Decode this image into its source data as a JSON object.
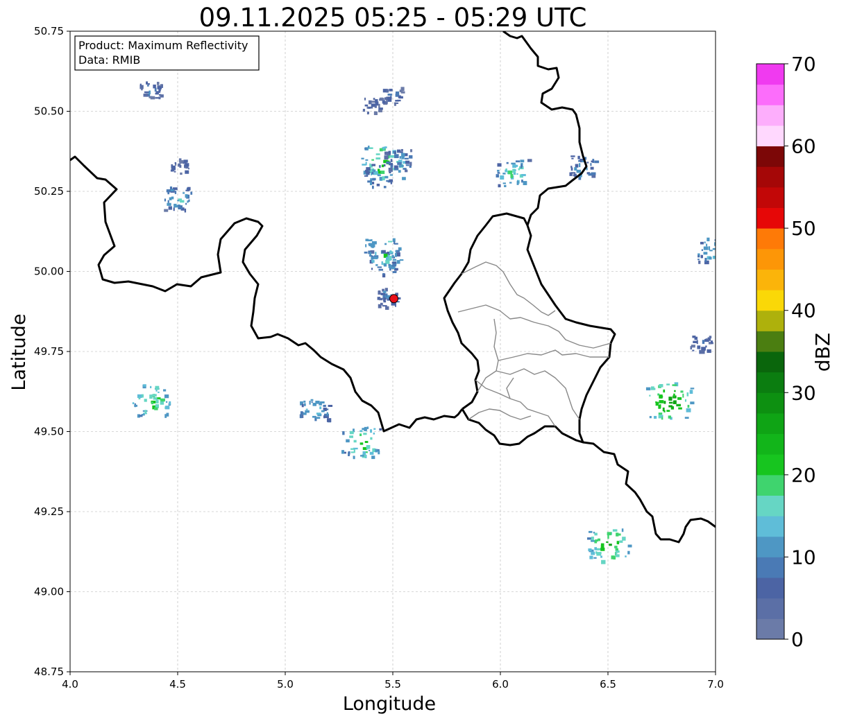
{
  "title": "09.11.2025 05:25 - 05:29 UTC",
  "info_box": {
    "line1": "Product: Maximum Reflectivity",
    "line2": "Data: RMIB"
  },
  "axes": {
    "xlabel": "Longitude",
    "ylabel": "Latitude",
    "xlim": [
      4.0,
      7.0
    ],
    "ylim": [
      48.75,
      50.75
    ],
    "xticks": [
      4.0,
      4.5,
      5.0,
      5.5,
      6.0,
      6.5,
      7.0
    ],
    "xtick_labels": [
      "4.0",
      "4.5",
      "5.0",
      "5.5",
      "6.0",
      "6.5",
      "7.0"
    ],
    "yticks": [
      48.75,
      49.0,
      49.25,
      49.5,
      49.75,
      50.0,
      50.25,
      50.5,
      50.75
    ],
    "ytick_labels": [
      "48.75",
      "49.00",
      "49.25",
      "49.50",
      "49.75",
      "50.00",
      "50.25",
      "50.50",
      "50.75"
    ],
    "grid": true
  },
  "colorbar": {
    "label": "dBZ",
    "min": 0,
    "max": 70,
    "ticks": [
      0,
      10,
      20,
      30,
      40,
      50,
      60,
      70
    ],
    "tick_labels": [
      "0",
      "10",
      "20",
      "30",
      "40",
      "50",
      "60",
      "70"
    ],
    "colors": [
      "#6b7ba8",
      "#5b6fa6",
      "#4c64a4",
      "#4a7ab5",
      "#4e97c4",
      "#5fbdd8",
      "#66d6c4",
      "#3fd46e",
      "#17c51f",
      "#12b51a",
      "#0fa415",
      "#0d9011",
      "#0b7d10",
      "#0a660c",
      "#4b7e11",
      "#aeb10c",
      "#fad807",
      "#fbb40a",
      "#fd9607",
      "#fe7a07",
      "#e60707",
      "#c20707",
      "#a50707",
      "#7c0707",
      "#ffd8fe",
      "#fdaefc",
      "#fc6dfb",
      "#f03af0"
    ]
  },
  "radar_site": {
    "lon": 5.505,
    "lat": 49.915,
    "color": "#e8101a"
  },
  "chart_data": {
    "type": "heatmap",
    "title": "09.11.2025 05:25 - 05:29 UTC",
    "xlabel": "Longitude",
    "ylabel": "Latitude",
    "xlim": [
      4.0,
      7.0
    ],
    "ylim": [
      48.75,
      50.75
    ],
    "value_label": "dBZ",
    "value_range": [
      0,
      70
    ],
    "echo_cells": [
      {
        "lon": 5.45,
        "lat": 50.34,
        "dbz": 25
      },
      {
        "lon": 5.43,
        "lat": 50.3,
        "dbz": 14
      },
      {
        "lon": 5.52,
        "lat": 50.35,
        "dbz": 12
      },
      {
        "lon": 5.49,
        "lat": 50.55,
        "dbz": 8
      },
      {
        "lon": 5.4,
        "lat": 50.52,
        "dbz": 6
      },
      {
        "lon": 5.45,
        "lat": 50.03,
        "dbz": 15
      },
      {
        "lon": 5.45,
        "lat": 50.06,
        "dbz": 20
      },
      {
        "lon": 5.47,
        "lat": 49.92,
        "dbz": 10
      },
      {
        "lon": 4.5,
        "lat": 50.23,
        "dbz": 14
      },
      {
        "lon": 4.37,
        "lat": 50.57,
        "dbz": 8
      },
      {
        "lon": 4.51,
        "lat": 50.33,
        "dbz": 6
      },
      {
        "lon": 6.98,
        "lat": 50.07,
        "dbz": 15
      },
      {
        "lon": 6.93,
        "lat": 49.78,
        "dbz": 8
      },
      {
        "lon": 6.78,
        "lat": 49.6,
        "dbz": 28
      },
      {
        "lon": 6.38,
        "lat": 50.33,
        "dbz": 12
      },
      {
        "lon": 6.5,
        "lat": 49.15,
        "dbz": 25
      },
      {
        "lon": 6.05,
        "lat": 50.31,
        "dbz": 18
      },
      {
        "lon": 5.35,
        "lat": 49.47,
        "dbz": 22
      },
      {
        "lon": 5.13,
        "lat": 49.57,
        "dbz": 15
      },
      {
        "lon": 4.37,
        "lat": 49.6,
        "dbz": 22
      }
    ]
  }
}
